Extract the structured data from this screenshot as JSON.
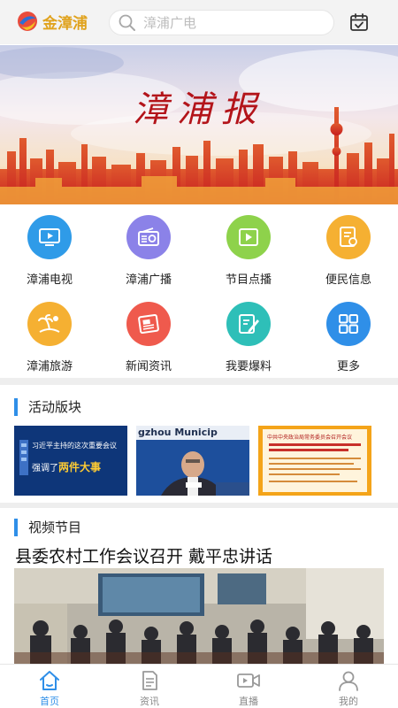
{
  "header": {
    "logo_text": "金漳浦",
    "search_placeholder": "漳浦广电",
    "calendar_icon": "calendar-check-icon"
  },
  "banner": {
    "title": "漳浦报"
  },
  "grid": {
    "items": [
      {
        "label": "漳浦电视",
        "icon": "tv-icon",
        "color": "#2f9be8"
      },
      {
        "label": "漳浦广播",
        "icon": "radio-icon",
        "color": "#8b82e8"
      },
      {
        "label": "节目点播",
        "icon": "video-play-icon",
        "color": "#8ed24b"
      },
      {
        "label": "便民信息",
        "icon": "info-doc-icon",
        "color": "#f5b032"
      },
      {
        "label": "漳浦旅游",
        "icon": "palm-tree-icon",
        "color": "#f5b032"
      },
      {
        "label": "新闻资讯",
        "icon": "newspaper-icon",
        "color": "#ef5a4d"
      },
      {
        "label": "我要爆料",
        "icon": "edit-report-icon",
        "color": "#2ebfb8"
      },
      {
        "label": "更多",
        "icon": "grid-more-icon",
        "color": "#2f8fe8"
      }
    ]
  },
  "activity": {
    "title": "活动版块",
    "thumbs": [
      {
        "line1": "习近平主持的这次重要会议",
        "line2": "强调了",
        "highlight": "两件大事"
      },
      {
        "caption": "gzhou Municip"
      },
      {
        "caption": "中共中央政治局常务委员会召开会议"
      }
    ]
  },
  "video": {
    "title": "视频节目",
    "headline": "县委农村工作会议召开 戴平忠讲话"
  },
  "tabbar": {
    "items": [
      {
        "label": "首页",
        "icon": "home-icon",
        "active": true
      },
      {
        "label": "资讯",
        "icon": "document-icon",
        "active": false
      },
      {
        "label": "直播",
        "icon": "live-camera-icon",
        "active": false
      },
      {
        "label": "我的",
        "icon": "user-icon",
        "active": false
      }
    ]
  },
  "colors": {
    "accent": "#2f8fe8",
    "logo": "#e0a21c",
    "banner_title": "#b3141a"
  }
}
